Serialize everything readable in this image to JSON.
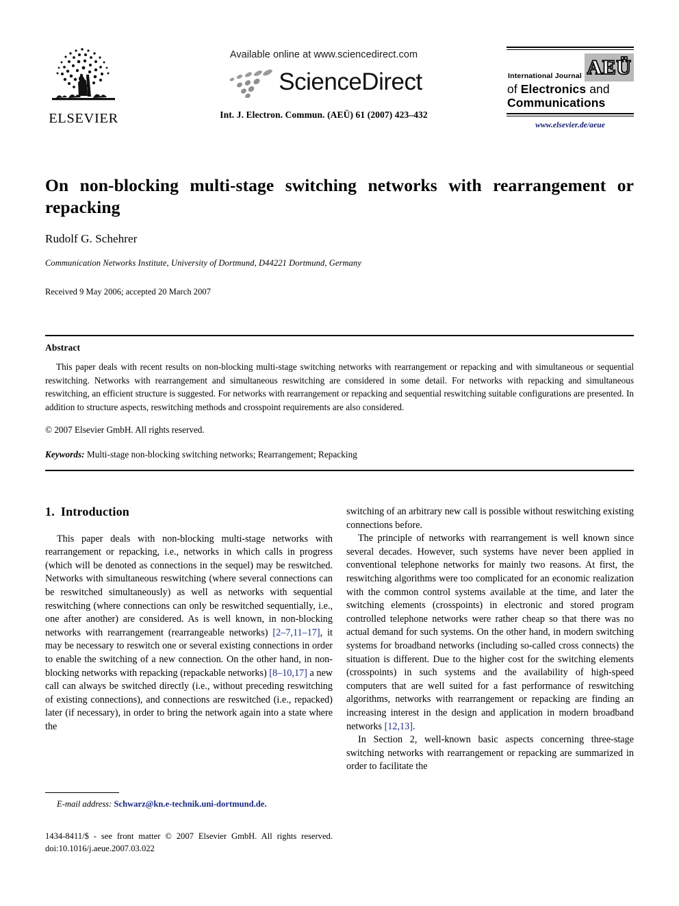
{
  "header": {
    "publisher_name": "ELSEVIER",
    "available_online": "Available online at www.sciencedirect.com",
    "sciencedirect_wordmark": "ScienceDirect",
    "citation_line": "Int. J. Electron. Commun. (AEÜ) 61 (2007) 423–432",
    "journal_logo": {
      "line_intl": "International Journal",
      "aeu_mark": "AEÜ",
      "line_of": "of",
      "line_electronics": "Electronics",
      "line_and": "and",
      "line_communications": "Communications",
      "url": "www.elsevier.de/aeue",
      "url_color": "#101a6e",
      "aeu_box_color": "#b9b9b9"
    }
  },
  "article": {
    "title": "On non-blocking multi-stage switching networks with rearrangement or repacking",
    "author": "Rudolf G. Schehrer",
    "affiliation": "Communication Networks Institute, University of Dortmund, D44221 Dortmund, Germany",
    "history": "Received 9 May 2006; accepted 20 March 2007"
  },
  "abstract": {
    "heading": "Abstract",
    "text": "This paper deals with recent results on non-blocking multi-stage switching networks with rearrangement or repacking and with simultaneous or sequential reswitching. Networks with rearrangement and simultaneous reswitching are considered in some detail. For networks with repacking and simultaneous reswitching, an efficient structure is suggested. For networks with rearrangement or repacking and sequential reswitching suitable configurations are presented. In addition to structure aspects, reswitching methods and crosspoint requirements are also considered.",
    "copyright": "© 2007 Elsevier GmbH. All rights reserved.",
    "keywords_label": "Keywords:",
    "keywords_value": "Multi-stage non-blocking switching networks; Rearrangement; Repacking"
  },
  "body": {
    "section_number": "1.",
    "section_title": "Introduction",
    "left_paragraph_1_a": "This paper deals with non-blocking multi-stage networks with rearrangement or repacking, i.e., networks in which calls in progress (which will be denoted as connections in the sequel) may be reswitched. Networks with simultaneous reswitching (where several connections can be reswitched simultaneously) as well as networks with sequential reswitching (where connections can only be reswitched sequentially, i.e., one after another) are considered. As is well known, in non-blocking networks with rearrangement (rearrangeable networks) ",
    "left_ref_1": "[2–7,11–17]",
    "left_paragraph_1_b": ", it may be necessary to reswitch one or several existing connections in order to enable the switching of a new connection. On the other hand, in non-blocking networks with repacking (repackable networks) ",
    "left_ref_2": "[8–10,17]",
    "left_paragraph_1_c": " a new call can always be switched directly (i.e., without preceding reswitching of existing connections), and connections are reswitched (i.e., repacked) later (if necessary), in order to bring the network again into a state where the",
    "right_paragraph_1": "switching of an arbitrary new call is possible without reswitching existing connections before.",
    "right_paragraph_2_a": "The principle of networks with rearrangement is well known since several decades. However, such systems have never been applied in conventional telephone networks for mainly two reasons. At first, the reswitching algorithms were too complicated for an economic realization with the common control systems available at the time, and later the switching elements (crosspoints) in electronic and stored program controlled telephone networks were rather cheap so that there was no actual demand for such systems. On the other hand, in modern switching systems for broadband networks (including so-called cross connects) the situation is different. Due to the higher cost for the switching elements (crosspoints) in such systems and the availability of high-speed computers that are well suited for a fast performance of reswitching algorithms, networks with rearrangement or repacking are finding an increasing interest in the design and application in modern broadband networks ",
    "right_ref_1": "[12,13]",
    "right_paragraph_2_b": ".",
    "right_paragraph_3": "In Section 2, well-known basic aspects concerning three-stage switching networks with rearrangement or repacking are summarized in order to facilitate the",
    "ref_link_color": "#1b2a86"
  },
  "footnote": {
    "email_label": "E-mail address:",
    "email_value": "Schwarz@kn.e-technik.uni-dortmund.de.",
    "email_color": "#1b2a86"
  },
  "footer": {
    "front_matter": "1434-8411/$ - see front matter © 2007 Elsevier GmbH. All rights reserved.",
    "doi": "doi:10.1016/j.aeue.2007.03.022"
  }
}
